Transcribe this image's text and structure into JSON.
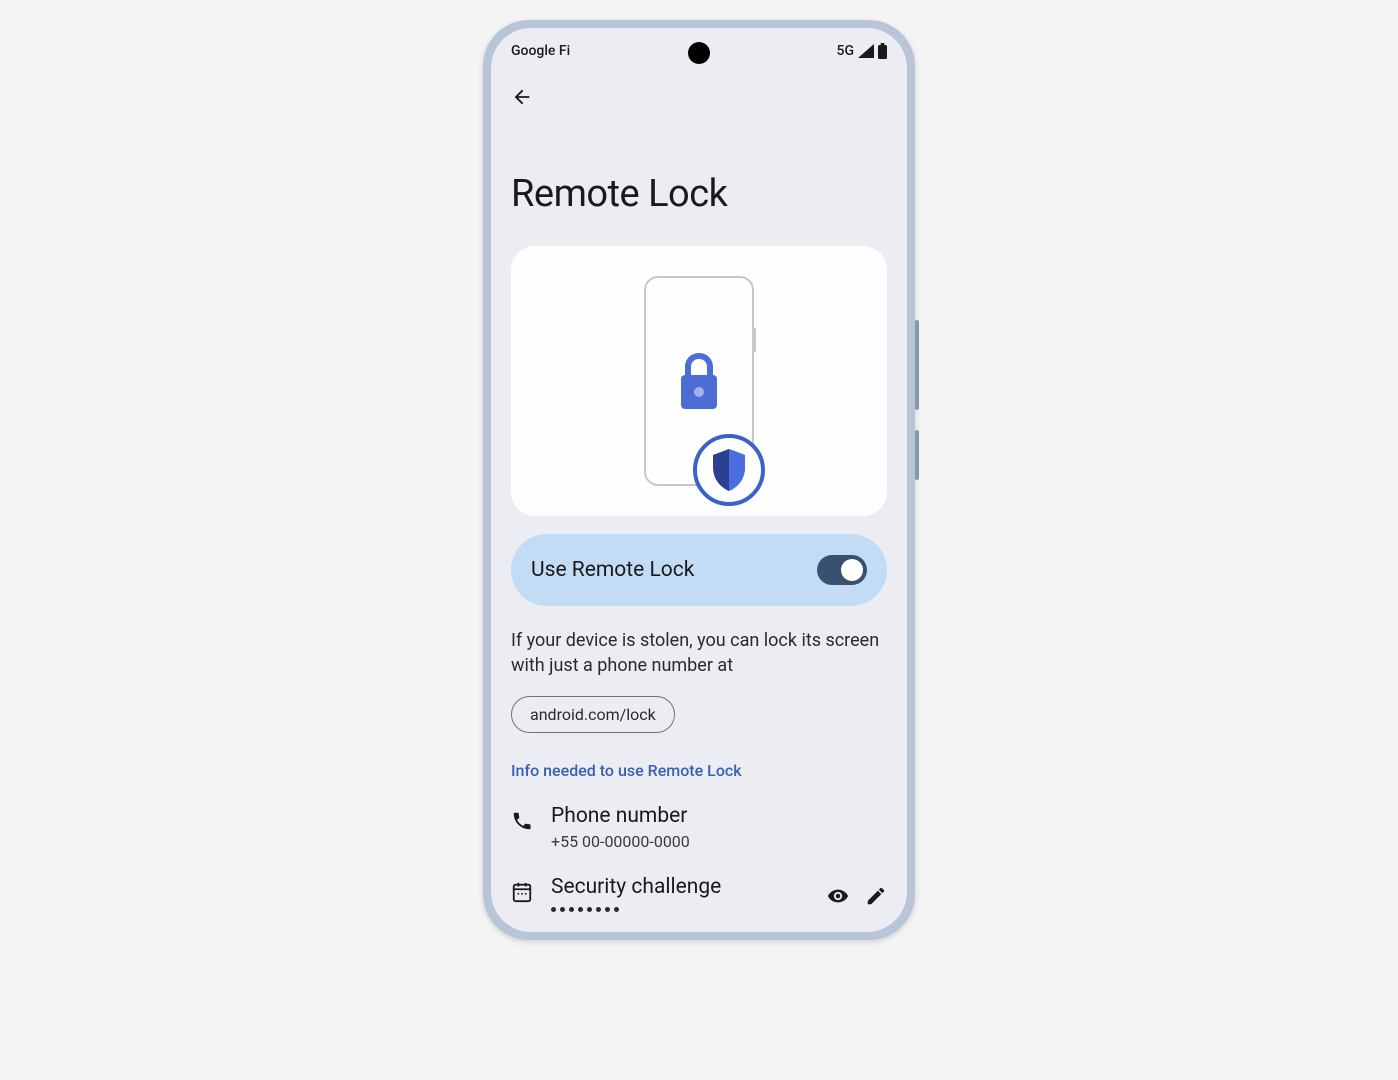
{
  "statusBar": {
    "carrier": "Google Fi",
    "network": "5G"
  },
  "pageTitle": "Remote Lock",
  "toggle": {
    "label": "Use Remote Lock",
    "on": true
  },
  "description": "If your device is stolen, you can lock its screen with just a phone number at",
  "linkChip": "android.com/lock",
  "sectionHeader": "Info needed to use Remote Lock",
  "phoneItem": {
    "title": "Phone number",
    "value": "+55 00-00000-0000"
  },
  "securityItem": {
    "title": "Security challenge"
  }
}
